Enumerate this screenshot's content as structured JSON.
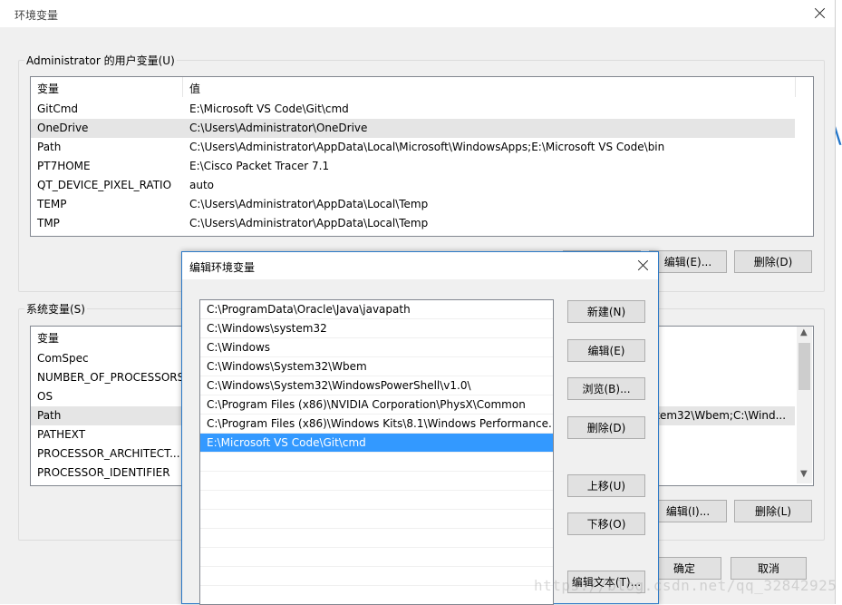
{
  "parent": {
    "title": "环境变量",
    "user_group_label": "Administrator 的用户变量(U)",
    "user_columns": [
      "变量",
      "值"
    ],
    "user_vars": [
      {
        "name": "GitCmd",
        "value": "E:\\Microsoft VS Code\\Git\\cmd",
        "selected": false
      },
      {
        "name": "OneDrive",
        "value": "C:\\Users\\Administrator\\OneDrive",
        "selected": true
      },
      {
        "name": "Path",
        "value": "C:\\Users\\Administrator\\AppData\\Local\\Microsoft\\WindowsApps;E:\\Microsoft VS Code\\bin",
        "selected": false
      },
      {
        "name": "PT7HOME",
        "value": "E:\\Cisco Packet Tracer 7.1",
        "selected": false
      },
      {
        "name": "QT_DEVICE_PIXEL_RATIO",
        "value": "auto",
        "selected": false
      },
      {
        "name": "TEMP",
        "value": "C:\\Users\\Administrator\\AppData\\Local\\Temp",
        "selected": false
      },
      {
        "name": "TMP",
        "value": "C:\\Users\\Administrator\\AppData\\Local\\Temp",
        "selected": false
      }
    ],
    "user_buttons": {
      "edit": "编辑(E)...",
      "delete": "删除(D)"
    },
    "system_group_label": "系统变量(S)",
    "system_columns": [
      "变量"
    ],
    "system_vars": [
      {
        "name": "ComSpec",
        "value": "",
        "selected": false
      },
      {
        "name": "NUMBER_OF_PROCESSORS",
        "value": "",
        "selected": false
      },
      {
        "name": "OS",
        "value": "",
        "selected": false
      },
      {
        "name": "Path",
        "value": "stem32\\Wbem;C:\\Wind...",
        "selected": true
      },
      {
        "name": "PATHEXT",
        "value": "",
        "selected": false
      },
      {
        "name": "PROCESSOR_ARCHITECT...",
        "value": "",
        "selected": false
      },
      {
        "name": "PROCESSOR_IDENTIFIER",
        "value": "",
        "selected": false
      }
    ],
    "system_buttons": {
      "edit": "编辑(I)...",
      "delete": "删除(L)"
    },
    "ok": "确定",
    "cancel": "取消"
  },
  "dialog": {
    "title": "编辑环境变量",
    "paths": [
      {
        "text": "C:\\ProgramData\\Oracle\\Java\\javapath",
        "selected": false
      },
      {
        "text": "C:\\Windows\\system32",
        "selected": false
      },
      {
        "text": "C:\\Windows",
        "selected": false
      },
      {
        "text": "C:\\Windows\\System32\\Wbem",
        "selected": false
      },
      {
        "text": "C:\\Windows\\System32\\WindowsPowerShell\\v1.0\\",
        "selected": false
      },
      {
        "text": "C:\\Program Files (x86)\\NVIDIA Corporation\\PhysX\\Common",
        "selected": false
      },
      {
        "text": "C:\\Program Files (x86)\\Windows Kits\\8.1\\Windows Performance...",
        "selected": false
      },
      {
        "text": "E:\\Microsoft VS Code\\Git\\cmd",
        "selected": true
      }
    ],
    "buttons": {
      "new": "新建(N)",
      "edit": "编辑(E)",
      "browse": "浏览(B)...",
      "delete": "删除(D)",
      "move_up": "上移(U)",
      "move_down": "下移(O)",
      "edit_text": "编辑文本(T)..."
    }
  },
  "watermark": "https://blog.csdn.net/qq_32842925",
  "colors": {
    "selection": "#3399ff",
    "dialog_border": "#2b79c7"
  }
}
